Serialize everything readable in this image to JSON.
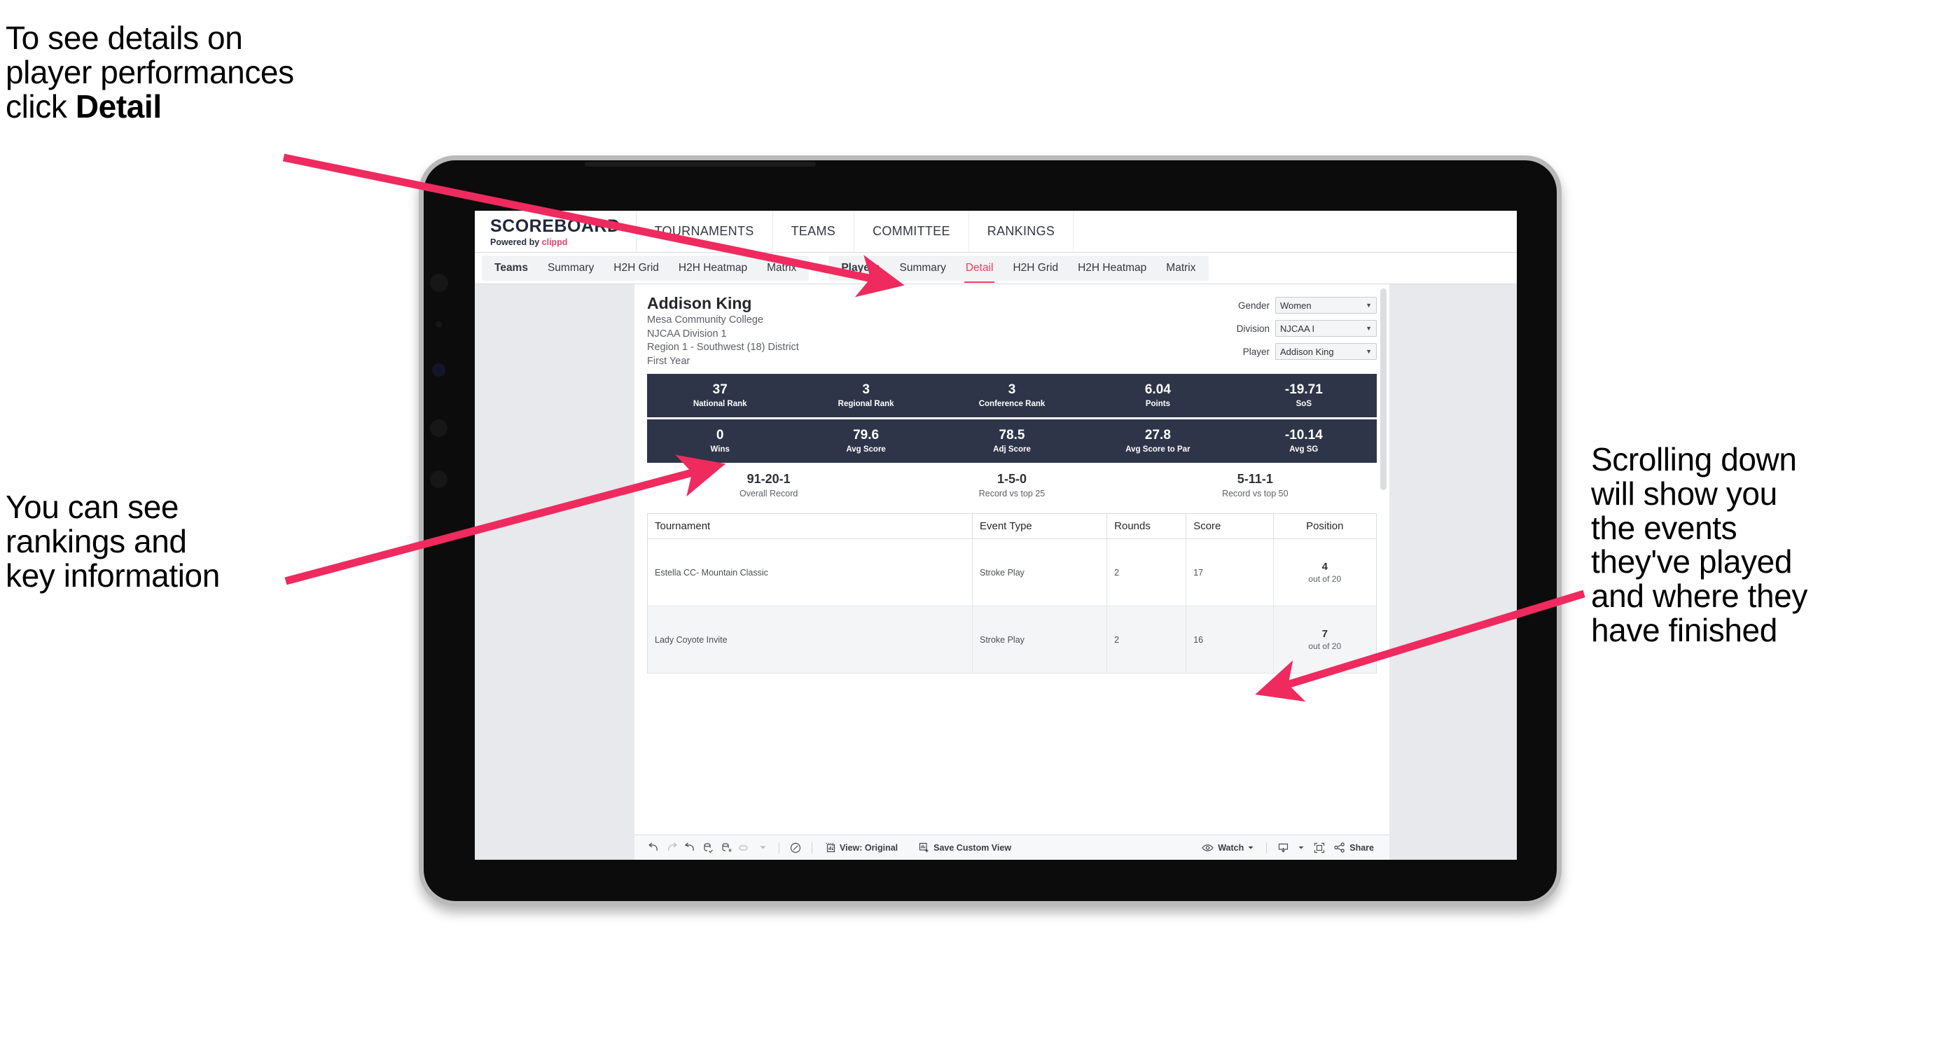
{
  "annotations": {
    "detail": "To see details on\nplayer performances\nclick ",
    "detail_bold": "Detail",
    "rankings": "You can see\nrankings and\nkey information",
    "scrolling": "Scrolling down\nwill show you\nthe events\nthey've played\nand where they\nhave finished"
  },
  "app": {
    "brand": {
      "title": "SCOREBOARD",
      "powered_prefix": "Powered by ",
      "powered_name": "clippd"
    },
    "topnav": [
      {
        "label": "TOURNAMENTS"
      },
      {
        "label": "TEAMS"
      },
      {
        "label": "COMMITTEE"
      },
      {
        "label": "RANKINGS"
      }
    ],
    "subnav": {
      "group_teams": [
        {
          "label": "Teams",
          "lead": true,
          "active": false
        },
        {
          "label": "Summary",
          "lead": false,
          "active": false
        },
        {
          "label": "H2H Grid",
          "lead": false,
          "active": false
        },
        {
          "label": "H2H Heatmap",
          "lead": false,
          "active": false
        },
        {
          "label": "Matrix",
          "lead": false,
          "active": false
        }
      ],
      "group_players": [
        {
          "label": "Players",
          "lead": true,
          "active": false
        },
        {
          "label": "Summary",
          "lead": false,
          "active": false
        },
        {
          "label": "Detail",
          "lead": false,
          "active": true
        },
        {
          "label": "H2H Grid",
          "lead": false,
          "active": false
        },
        {
          "label": "H2H Heatmap",
          "lead": false,
          "active": false
        },
        {
          "label": "Matrix",
          "lead": false,
          "active": false
        }
      ]
    }
  },
  "player": {
    "name": "Addison King",
    "school": "Mesa Community College",
    "division": "NJCAA Division 1",
    "region": "Region 1 - Southwest (18) District",
    "year": "First Year"
  },
  "filters": [
    {
      "label": "Gender",
      "value": "Women"
    },
    {
      "label": "Division",
      "value": "NJCAA I"
    },
    {
      "label": "Player",
      "value": "Addison King"
    }
  ],
  "stats_band_1": [
    {
      "value": "37",
      "label": "National Rank"
    },
    {
      "value": "3",
      "label": "Regional Rank"
    },
    {
      "value": "3",
      "label": "Conference Rank"
    },
    {
      "value": "6.04",
      "label": "Points"
    },
    {
      "value": "-19.71",
      "label": "SoS"
    }
  ],
  "stats_band_2": [
    {
      "value": "0",
      "label": "Wins"
    },
    {
      "value": "79.6",
      "label": "Avg Score"
    },
    {
      "value": "78.5",
      "label": "Adj Score"
    },
    {
      "value": "27.8",
      "label": "Avg Score to Par"
    },
    {
      "value": "-10.14",
      "label": "Avg SG"
    }
  ],
  "records": [
    {
      "value": "91-20-1",
      "label": "Overall Record"
    },
    {
      "value": "1-5-0",
      "label": "Record vs top 25"
    },
    {
      "value": "5-11-1",
      "label": "Record vs top 50"
    }
  ],
  "events_table": {
    "columns": [
      "Tournament",
      "Event Type",
      "Rounds",
      "Score",
      "Position"
    ],
    "rows": [
      {
        "tournament": "Estella CC- Mountain Classic",
        "event_type": "Stroke Play",
        "rounds": "2",
        "score": "17",
        "position": "4",
        "position_of": "out of 20"
      },
      {
        "tournament": "Lady Coyote Invite",
        "event_type": "Stroke Play",
        "rounds": "2",
        "score": "16",
        "position": "7",
        "position_of": "out of 20"
      }
    ]
  },
  "toolbar": {
    "view_label": "View: Original",
    "save_label": "Save Custom View",
    "watch_label": "Watch",
    "share_label": "Share"
  },
  "colors": {
    "accent_pink": "#e83e62",
    "navy": "#2e3549",
    "page_bg": "#e7e9ec"
  }
}
